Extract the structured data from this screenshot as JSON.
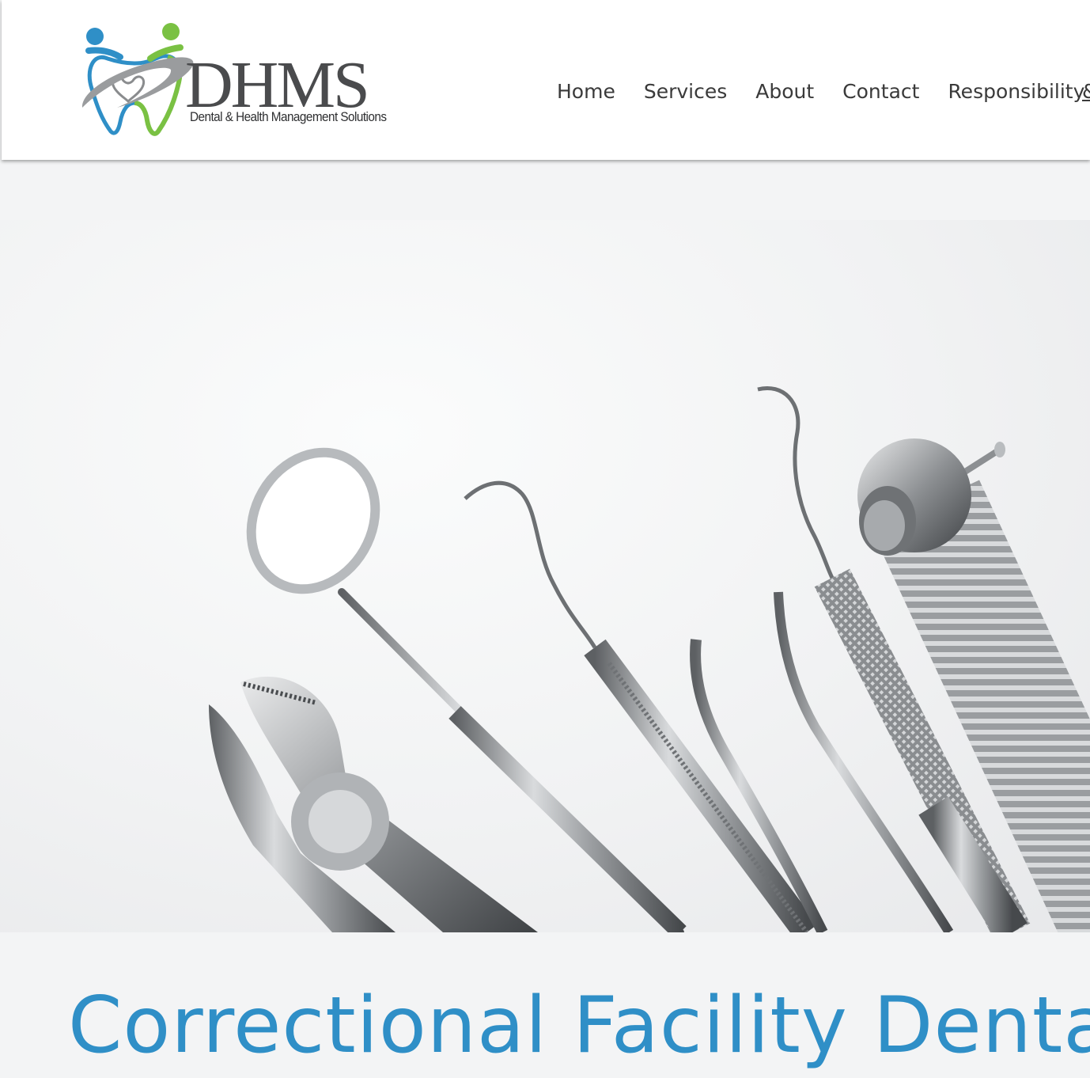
{
  "brand": {
    "name": "DHMS",
    "tagline": "Dental & Health Management Solutions",
    "colors": {
      "blue": "#2f8fc7",
      "green": "#7ac143",
      "gray": "#4a4b4d"
    }
  },
  "nav": {
    "items": [
      {
        "label": "Home"
      },
      {
        "label": "Services"
      },
      {
        "label": "About"
      },
      {
        "label": "Contact"
      },
      {
        "label": "Responsibility"
      }
    ],
    "overflow_label": "&"
  },
  "hero": {
    "image_icon": "dental-instruments-photo"
  },
  "main": {
    "title": "Correctional Facility Dental"
  }
}
